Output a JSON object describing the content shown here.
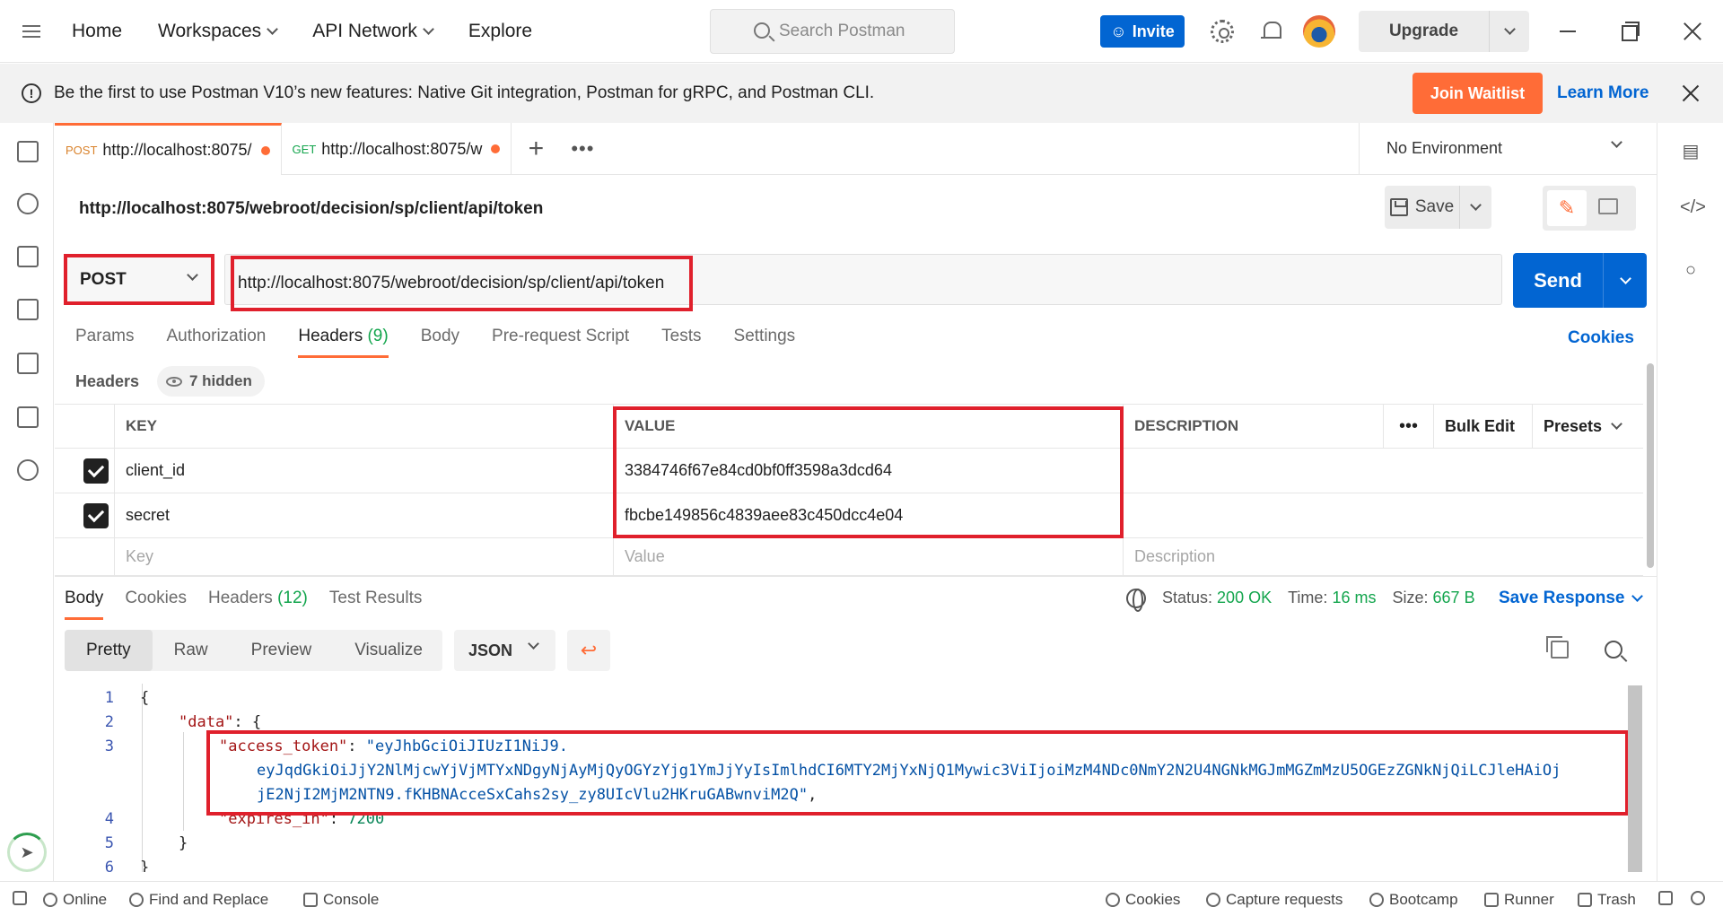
{
  "topbar": {
    "nav": [
      "Home",
      "Workspaces",
      "API Network",
      "Explore"
    ],
    "search_placeholder": "Search Postman",
    "invite": "Invite",
    "upgrade": "Upgrade"
  },
  "banner": {
    "message": "Be the first to use Postman V10’s new features: Native Git integration, Postman for gRPC, and Postman CLI.",
    "join": "Join Waitlist",
    "learn": "Learn More"
  },
  "tabs": [
    {
      "method": "POST",
      "title": "http://localhost:8075/"
    },
    {
      "method": "GET",
      "title": "http://localhost:8075/w"
    }
  ],
  "environment": "No Environment",
  "request": {
    "title": "http://localhost:8075/webroot/decision/sp/client/api/token",
    "method": "POST",
    "url": "http://localhost:8075/webroot/decision/sp/client/api/token",
    "save": "Save",
    "send": "Send",
    "tabs": {
      "params": "Params",
      "authorization": "Authorization",
      "headers": "Headers",
      "headers_count": "(9)",
      "body": "Body",
      "prerequest": "Pre-request Script",
      "tests": "Tests",
      "settings": "Settings"
    },
    "cookies": "Cookies",
    "headers_label": "Headers",
    "hidden": "7 hidden"
  },
  "headers_table": {
    "columns": {
      "key": "KEY",
      "value": "VALUE",
      "description": "DESCRIPTION"
    },
    "bulk_edit": "Bulk Edit",
    "presets": "Presets",
    "rows": [
      {
        "key": "client_id",
        "value": "3384746f67e84cd0bf0ff3598a3dcd64",
        "checked": true
      },
      {
        "key": "secret",
        "value": "fbcbe149856c4839aee83c450dcc4e04",
        "checked": true
      }
    ],
    "placeholders": {
      "key": "Key",
      "value": "Value",
      "description": "Description"
    }
  },
  "response": {
    "tabs": {
      "body": "Body",
      "cookies": "Cookies",
      "headers": "Headers",
      "headers_count": "(12)",
      "tests": "Test Results"
    },
    "status_label": "Status:",
    "status_value": "200 OK",
    "time_label": "Time:",
    "time_value": "16 ms",
    "size_label": "Size:",
    "size_value": "667 B",
    "save_response": "Save Response",
    "views": [
      "Pretty",
      "Raw",
      "Preview",
      "Visualize"
    ],
    "format": "JSON",
    "code": {
      "line_numbers": [
        "1",
        "2",
        "3",
        "4",
        "5",
        "6"
      ],
      "open_brace": "{",
      "data_key": "\"data\"",
      "access_token_key": "\"access_token\"",
      "token_line1": "\"eyJhbGciOiJIUzI1NiJ9.",
      "token_line2": "eyJqdGkiOiJjY2NlMjcwYjVjMTYxNDgyNjAyMjQyOGYzYjg1YmJjYyIsImlhdCI6MTY2MjYxNjQ1Mywic3ViIjoiMzM4NDc0NmY2N2U4NGNkMGJmMGZmMzU5OGEzZGNkNjQiLCJleHAiOj",
      "token_line3": "jE2NjI2MjM2NTN9.fKHBNAcceSxCahs2sy_zy8UIcVlu2HKruGABwnviM2Q\"",
      "expires_key": "\"expires_in\"",
      "expires_value": "7200",
      "close_inner": "}",
      "close_outer": "}"
    }
  },
  "statusbar": {
    "online": "Online",
    "find": "Find and Replace",
    "console": "Console",
    "cookies": "Cookies",
    "capture": "Capture requests",
    "bootcamp": "Bootcamp",
    "runner": "Runner",
    "trash": "Trash"
  }
}
